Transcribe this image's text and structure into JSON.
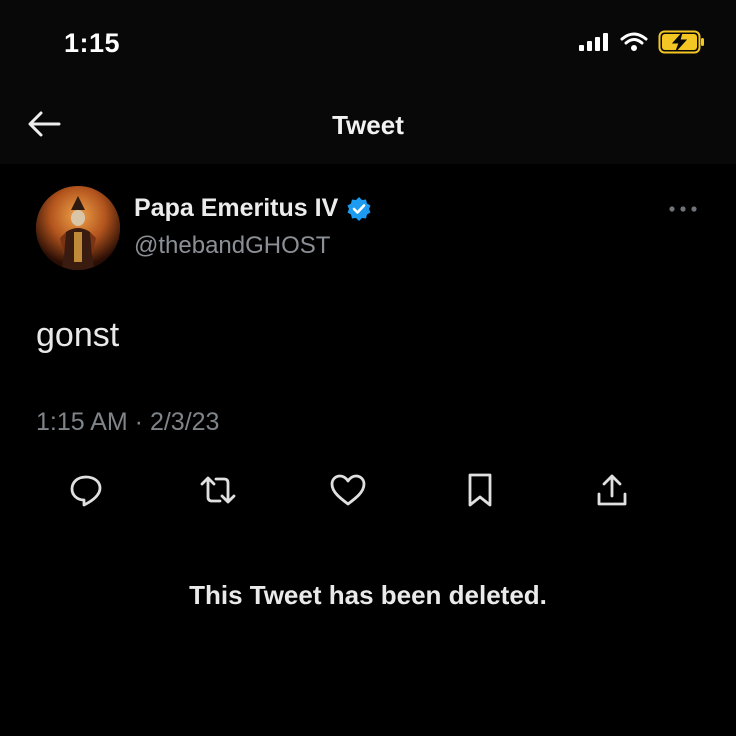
{
  "status_bar": {
    "time": "1:15",
    "icons": [
      "signal-icon",
      "wifi-icon",
      "battery-charging-icon"
    ],
    "battery_color": "#f3c623"
  },
  "nav": {
    "back_icon": "arrow-left-icon",
    "title": "Tweet"
  },
  "tweet": {
    "author_name": "Papa Emeritus IV",
    "verified": true,
    "verified_color": "#1d9bf0",
    "handle": "@thebandGHOST",
    "more_icon": "more-horizontal-icon",
    "text": "gonst",
    "timestamp": "1:15 AM · 2/3/23",
    "actions": [
      {
        "name": "reply",
        "icon": "reply-icon"
      },
      {
        "name": "retweet",
        "icon": "retweet-icon"
      },
      {
        "name": "like",
        "icon": "heart-icon"
      },
      {
        "name": "bookmark",
        "icon": "bookmark-icon"
      },
      {
        "name": "share",
        "icon": "share-icon"
      }
    ]
  },
  "notice": "This Tweet has been deleted.",
  "colors": {
    "background": "#000000",
    "header_background": "#080808",
    "secondary_text": "#8b9096"
  }
}
